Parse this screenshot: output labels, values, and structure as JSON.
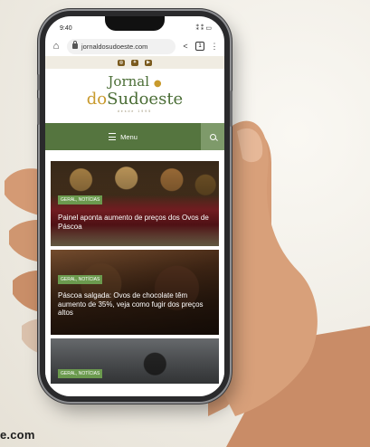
{
  "caption": "e.com",
  "status": {
    "time": "9:40",
    "right": "⁑ ⁑ ▭"
  },
  "browser": {
    "url": "jornaldosudoeste.com",
    "tab_count": "1"
  },
  "site": {
    "logo_line1": "Jornal",
    "logo_line2_a": "do",
    "logo_line2_b": "Sudoeste",
    "logo_tagline": "desde 1995",
    "menu_label": "Menu"
  },
  "articles": [
    {
      "tag": "GERAL, NOTÍCIAS",
      "title": "Painel aponta aumento de preços dos Ovos de Páscoa"
    },
    {
      "tag": "GERAL, NOTÍCIAS",
      "title": "Páscoa salgada: Ovos de chocolate têm aumento de 35%, veja como fugir dos preços altos"
    },
    {
      "tag": "GERAL, NOTÍCIAS",
      "title": ""
    }
  ],
  "colors": {
    "brand_green": "#55753f",
    "brand_gold": "#c89a2d",
    "tag_green": "#6b9a4e"
  }
}
